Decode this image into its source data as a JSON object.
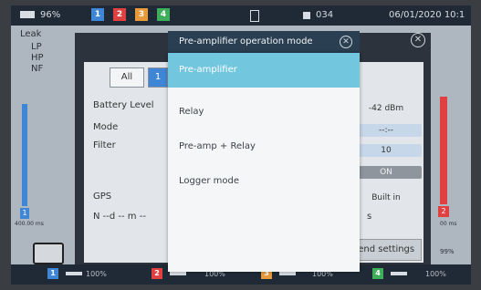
{
  "status": {
    "battery": "96%",
    "channels": [
      {
        "label": "1",
        "color": "#3f86d6"
      },
      {
        "label": "2",
        "color": "#e04040"
      },
      {
        "label": "3",
        "color": "#e89a3a"
      },
      {
        "label": "4",
        "color": "#3fae5a"
      }
    ],
    "storage": "034",
    "datetime": "06/01/2020 10:1"
  },
  "background": {
    "leak_label": "Leak",
    "filters": [
      "LP",
      "HP",
      "NF"
    ],
    "tab_all": "All",
    "tab_ch": "1",
    "rows": {
      "battery_level": "Battery Level",
      "mode": "Mode",
      "filter": "Filter",
      "gps": "GPS",
      "coords": "N --d -- m --"
    },
    "values": {
      "battery": "-42 dBm",
      "mode": "--:--",
      "filter": "10",
      "gps_switch": "ON",
      "gps": "Built in"
    },
    "send_button": "Send settings",
    "left_time": "400.00 ms",
    "right_time": "00 ms",
    "bottom": {
      "percent": "100%",
      "percent_right": "99%"
    }
  },
  "modal": {
    "title": "Pre-amplifier operation mode",
    "options": [
      {
        "label": "Pre-amplifier",
        "selected": true
      },
      {
        "label": "Relay",
        "selected": false
      },
      {
        "label": "Pre-amp + Relay",
        "selected": false
      },
      {
        "label": "Logger mode",
        "selected": false
      }
    ]
  }
}
